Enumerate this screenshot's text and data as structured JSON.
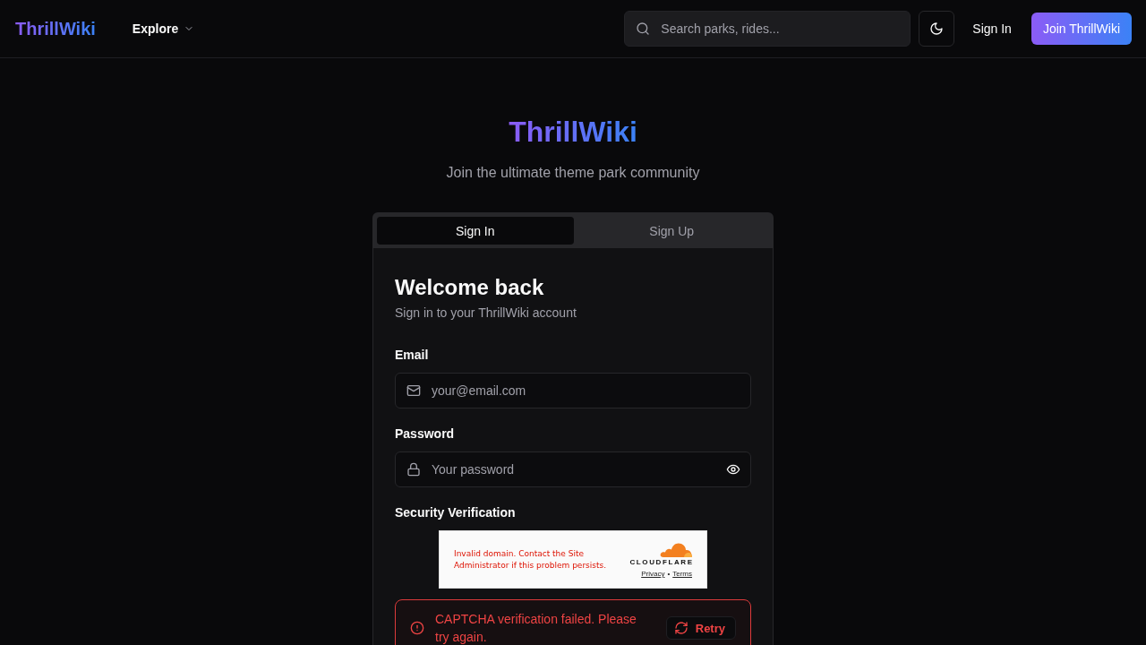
{
  "header": {
    "logo": "ThrillWiki",
    "nav": [
      {
        "label": "Explore"
      }
    ],
    "search": {
      "placeholder": "Search parks, rides..."
    },
    "sign_in": "Sign In",
    "join_button": "Join ThrillWiki"
  },
  "hero": {
    "title": "ThrillWiki",
    "subtitle": "Join the ultimate theme park community"
  },
  "auth_card": {
    "tabs": [
      {
        "label": "Sign In",
        "selected": true
      },
      {
        "label": "Sign Up",
        "selected": false
      }
    ],
    "heading": "Welcome back",
    "subheading": "Sign in to your ThrillWiki account",
    "fields": [
      {
        "kind": "email",
        "label": "Email",
        "placeholder": "your@email.com"
      },
      {
        "kind": "password",
        "label": "Password",
        "placeholder": "Your password"
      }
    ],
    "verification": {
      "label": "Security Verification",
      "widget": {
        "message": "Invalid domain. Contact the Site Administrator if this problem persists.",
        "brand": "CLOUDFLARE",
        "links": [
          "Privacy",
          "Terms"
        ],
        "link_separator": "•"
      }
    },
    "alert": {
      "message": "CAPTCHA verification failed. Please try again.",
      "action": "Retry"
    }
  }
}
